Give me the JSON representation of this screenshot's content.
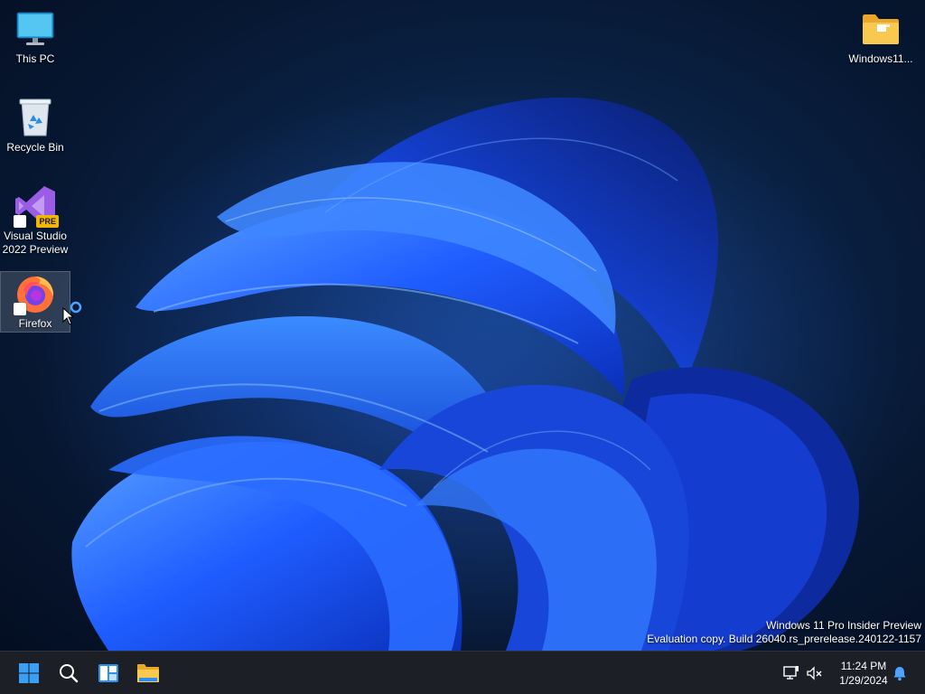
{
  "desktop": {
    "icons": [
      {
        "label": "This PC"
      },
      {
        "label": "Recycle Bin"
      },
      {
        "label": "Visual Studio 2022 Preview",
        "badge": "PRE"
      },
      {
        "label": "Firefox"
      },
      {
        "label": "Windows11..."
      }
    ],
    "watermark": {
      "line1": "Windows 11 Pro Insider Preview",
      "line2": "Evaluation copy. Build 26040.rs_prerelease.240122-1157"
    }
  },
  "taskbar": {
    "pinned": [
      {
        "icon": "windows-start-icon"
      },
      {
        "icon": "search-icon"
      },
      {
        "icon": "widgets-icon"
      },
      {
        "icon": "file-explorer-icon"
      }
    ],
    "tray": {
      "icons": [
        "network-icon",
        "speaker-muted-icon",
        "notification-bell-icon"
      ],
      "time": "11:24 PM",
      "date": "1/29/2024"
    }
  },
  "colors": {
    "accent": "#1a73ff",
    "taskbar_bg": "#1c1f26",
    "wallpaper_dark": "#07152c"
  }
}
